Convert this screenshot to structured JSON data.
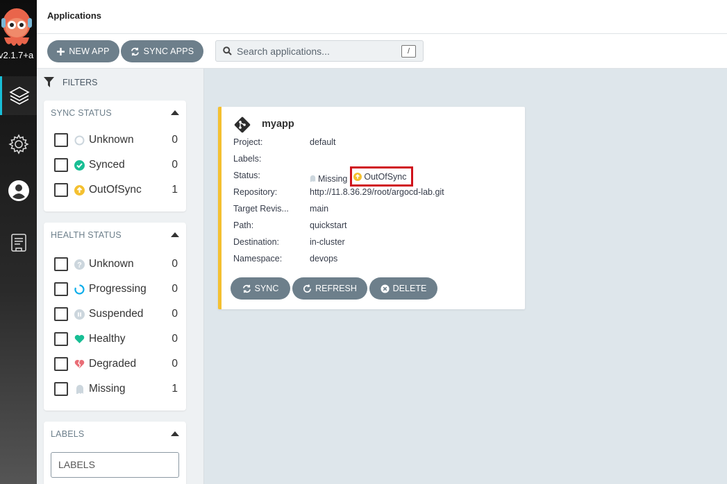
{
  "nav": {
    "version": "v2.1.7+a",
    "items": [
      "applications-icon",
      "settings-icon",
      "user-icon",
      "docs-icon"
    ]
  },
  "header": {
    "title": "Applications"
  },
  "toolbar": {
    "new_app": "NEW APP",
    "sync_apps": "SYNC APPS",
    "search_placeholder": "Search applications...",
    "search_shortcut": "/"
  },
  "filters": {
    "title": "FILTERS",
    "sync_status": {
      "title": "SYNC STATUS",
      "items": [
        {
          "label": "Unknown",
          "count": "0",
          "icon": "circle-outline-icon"
        },
        {
          "label": "Synced",
          "count": "0",
          "icon": "check-circle-icon"
        },
        {
          "label": "OutOfSync",
          "count": "1",
          "icon": "arrow-up-circle-icon"
        }
      ]
    },
    "health_status": {
      "title": "HEALTH STATUS",
      "items": [
        {
          "label": "Unknown",
          "count": "0",
          "icon": "question-circle-icon"
        },
        {
          "label": "Progressing",
          "count": "0",
          "icon": "spinner-icon"
        },
        {
          "label": "Suspended",
          "count": "0",
          "icon": "pause-circle-icon"
        },
        {
          "label": "Healthy",
          "count": "0",
          "icon": "heart-icon"
        },
        {
          "label": "Degraded",
          "count": "0",
          "icon": "broken-heart-icon"
        },
        {
          "label": "Missing",
          "count": "1",
          "icon": "ghost-icon"
        }
      ]
    },
    "labels": {
      "title": "LABELS",
      "placeholder": "LABELS"
    }
  },
  "app": {
    "name": "myapp",
    "fields": {
      "project": {
        "label": "Project:",
        "value": "default"
      },
      "labels": {
        "label": "Labels:",
        "value": ""
      },
      "status": {
        "label": "Status:",
        "health": "Missing",
        "sync": "OutOfSync"
      },
      "repository": {
        "label": "Repository:",
        "value": "http://11.8.36.29/root/argocd-lab.git"
      },
      "target_revision": {
        "label": "Target Revis...",
        "value": "main"
      },
      "path": {
        "label": "Path:",
        "value": "quickstart"
      },
      "destination": {
        "label": "Destination:",
        "value": "in-cluster"
      },
      "namespace": {
        "label": "Namespace:",
        "value": "devops"
      }
    },
    "actions": {
      "sync": "SYNC",
      "refresh": "REFRESH",
      "delete": "DELETE"
    }
  },
  "colors": {
    "accent_teal": "#18bfd8",
    "button_gray": "#6d7f8b",
    "outofsync": "#f4c030",
    "synced": "#18be94",
    "healthy": "#18be94",
    "degraded": "#e96d76",
    "highlight_box": "#d0121b"
  }
}
